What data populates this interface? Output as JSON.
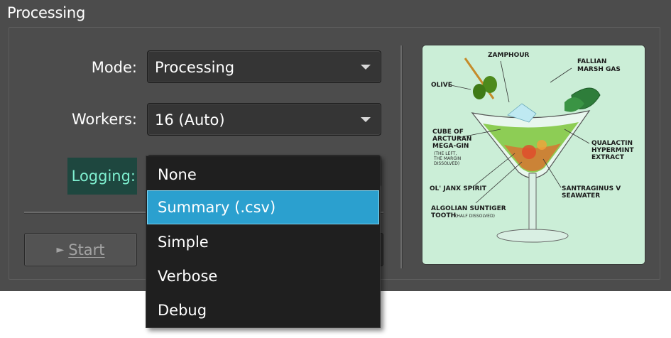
{
  "window": {
    "title": "Processing"
  },
  "form": {
    "mode_label": "Mode:",
    "mode_value": "Processing",
    "workers_label": "Workers:",
    "workers_value": "16 (Auto)",
    "logging_label": "Logging:",
    "logging_value": "Summary (.csv)"
  },
  "dropdown": {
    "options": [
      "None",
      "Summary (.csv)",
      "Simple",
      "Verbose",
      "Debug"
    ],
    "selected_index": 1
  },
  "buttons": {
    "start_label": "Start",
    "start_glyph": "►"
  },
  "illustration": {
    "labels": {
      "zamphour": "ZAMPHOUR",
      "fallian_1": "FALLIAN",
      "fallian_2": "MARSH GAS",
      "olive": "OLIVE",
      "cube_1": "CUBE OF",
      "cube_2": "ARCTURAN",
      "cube_3": "MEGA-GIN",
      "cube_note_1": "(THE LEFT,",
      "cube_note_2": "THE MARGIN",
      "cube_note_3": "DISSOLVED)",
      "qualactin_1": "QUALACTIN",
      "qualactin_2": "HYPERMINT",
      "qualactin_3": "EXTRACT",
      "janx": "OL' JANX SPIRIT",
      "santraginus_1": "SANTRAGINUS V",
      "santraginus_2": "SEAWATER",
      "algolian_1": "ALGOLIAN SUNTIGER",
      "algolian_2": "TOOTH",
      "algolian_note": "(HALF DISSOLVED)"
    }
  },
  "colors": {
    "window_bg": "#4c4c4c",
    "combo_bg": "#353535",
    "dropdown_bg": "#1f1f1f",
    "selected_bg": "#2ba0cf",
    "logging_label_bg": "#1e473f",
    "logging_label_fg": "#7ff0d0",
    "image_bg": "#cbeed7"
  },
  "icons": {
    "combo_arrow": "chevron-down-icon",
    "start_glyph": "play-icon"
  }
}
